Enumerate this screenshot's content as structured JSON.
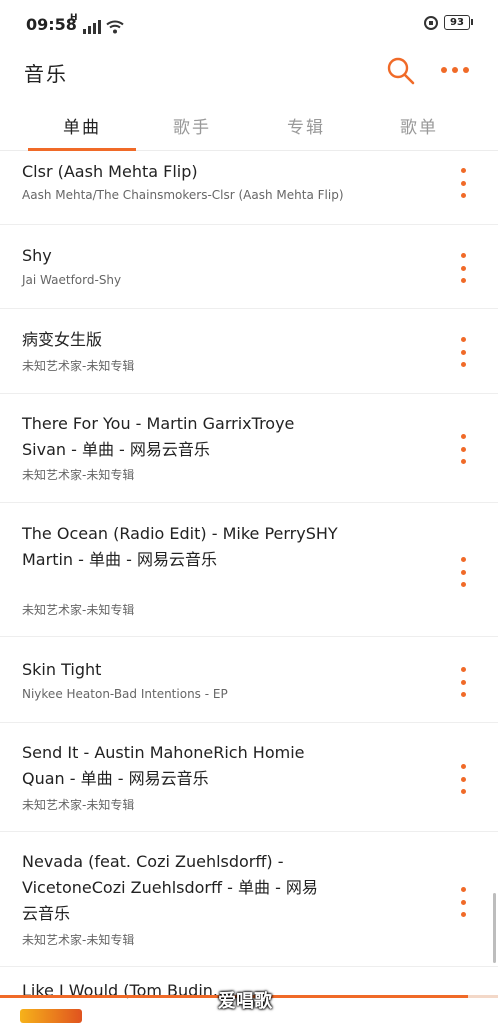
{
  "status_bar": {
    "time": "09:58",
    "network_label": "H",
    "battery_level": "93"
  },
  "header": {
    "title": "音乐",
    "search_icon": "search-icon",
    "more_icon": "more-horizontal-icon"
  },
  "tabs": [
    {
      "label": "单曲",
      "active": true
    },
    {
      "label": "歌手",
      "active": false
    },
    {
      "label": "专辑",
      "active": false
    },
    {
      "label": "歌单",
      "active": false
    }
  ],
  "songs": [
    {
      "title": "Clsr (Aash Mehta Flip)",
      "subtitle": "Aash Mehta/The Chainsmokers-Clsr (Aash Mehta Flip)"
    },
    {
      "title": "Shy",
      "subtitle": "Jai Waetford-Shy"
    },
    {
      "title": "病变女生版",
      "subtitle": "未知艺术家-未知专辑"
    },
    {
      "title": "There For You - Martin GarrixTroye Sivan - 单曲 - 网易云音乐",
      "subtitle": "未知艺术家-未知专辑"
    },
    {
      "title": "The Ocean (Radio Edit) - Mike PerrySHY Martin - 单曲 - 网易云音乐",
      "subtitle": "未知艺术家-未知专辑"
    },
    {
      "title": "Skin Tight",
      "subtitle": "Niykee Heaton-Bad Intentions - EP"
    },
    {
      "title": "Send It - Austin MahoneRich Homie Quan - 单曲 - 网易云音乐",
      "subtitle": "未知艺术家-未知专辑"
    },
    {
      "title": "Nevada (feat. Cozi Zuehlsdorff) - VicetoneCozi Zuehlsdorff - 单曲 - 网易云音乐",
      "subtitle": "未知艺术家-未知专辑"
    }
  ],
  "now_playing": {
    "title": "Like I Would (Tom Budin...",
    "progress_fraction": 0.94
  },
  "watermark": "爱唱歌",
  "colors": {
    "accent": "#f06a28",
    "text_primary": "#222222",
    "text_secondary": "#666666",
    "tab_inactive": "#999999"
  }
}
